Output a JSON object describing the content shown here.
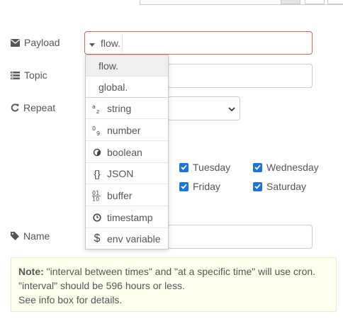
{
  "fields": {
    "payload_label": "Payload",
    "topic_label": "Topic",
    "repeat_label": "Repeat",
    "name_label": "Name"
  },
  "payload": {
    "type_label": "flow.",
    "value": ""
  },
  "days": {
    "tuesday": "Tuesday",
    "wednesday": "Wednesday",
    "friday": "Friday",
    "saturday": "Saturday"
  },
  "menu": {
    "items": [
      {
        "label": "flow.",
        "icon": ""
      },
      {
        "label": "global.",
        "icon": ""
      },
      {
        "label": "string",
        "icon": "string-type-icon"
      },
      {
        "label": "number",
        "icon": "number-type-icon"
      },
      {
        "label": "boolean",
        "icon": "boolean-type-icon"
      },
      {
        "label": "JSON",
        "icon": "json-type-icon"
      },
      {
        "label": "buffer",
        "icon": "buffer-type-icon"
      },
      {
        "label": "timestamp",
        "icon": "clock-icon"
      },
      {
        "label": "env variable",
        "icon": "dollar-icon"
      }
    ],
    "icon_glyphs": {
      "json": "{}",
      "dollar": "$"
    }
  },
  "note": {
    "bold": "Note:",
    "line1_rest": " \"interval between times\" and \"at a specific time\" will use cron.",
    "line2": "\"interval\" should be 596 hours or less.",
    "line3": "See info box for details."
  },
  "colors": {
    "error_border": "#d6615f",
    "checkbox": "#1a73e8",
    "note_bg": "#ffffee",
    "menu_hover": "#efefef"
  }
}
